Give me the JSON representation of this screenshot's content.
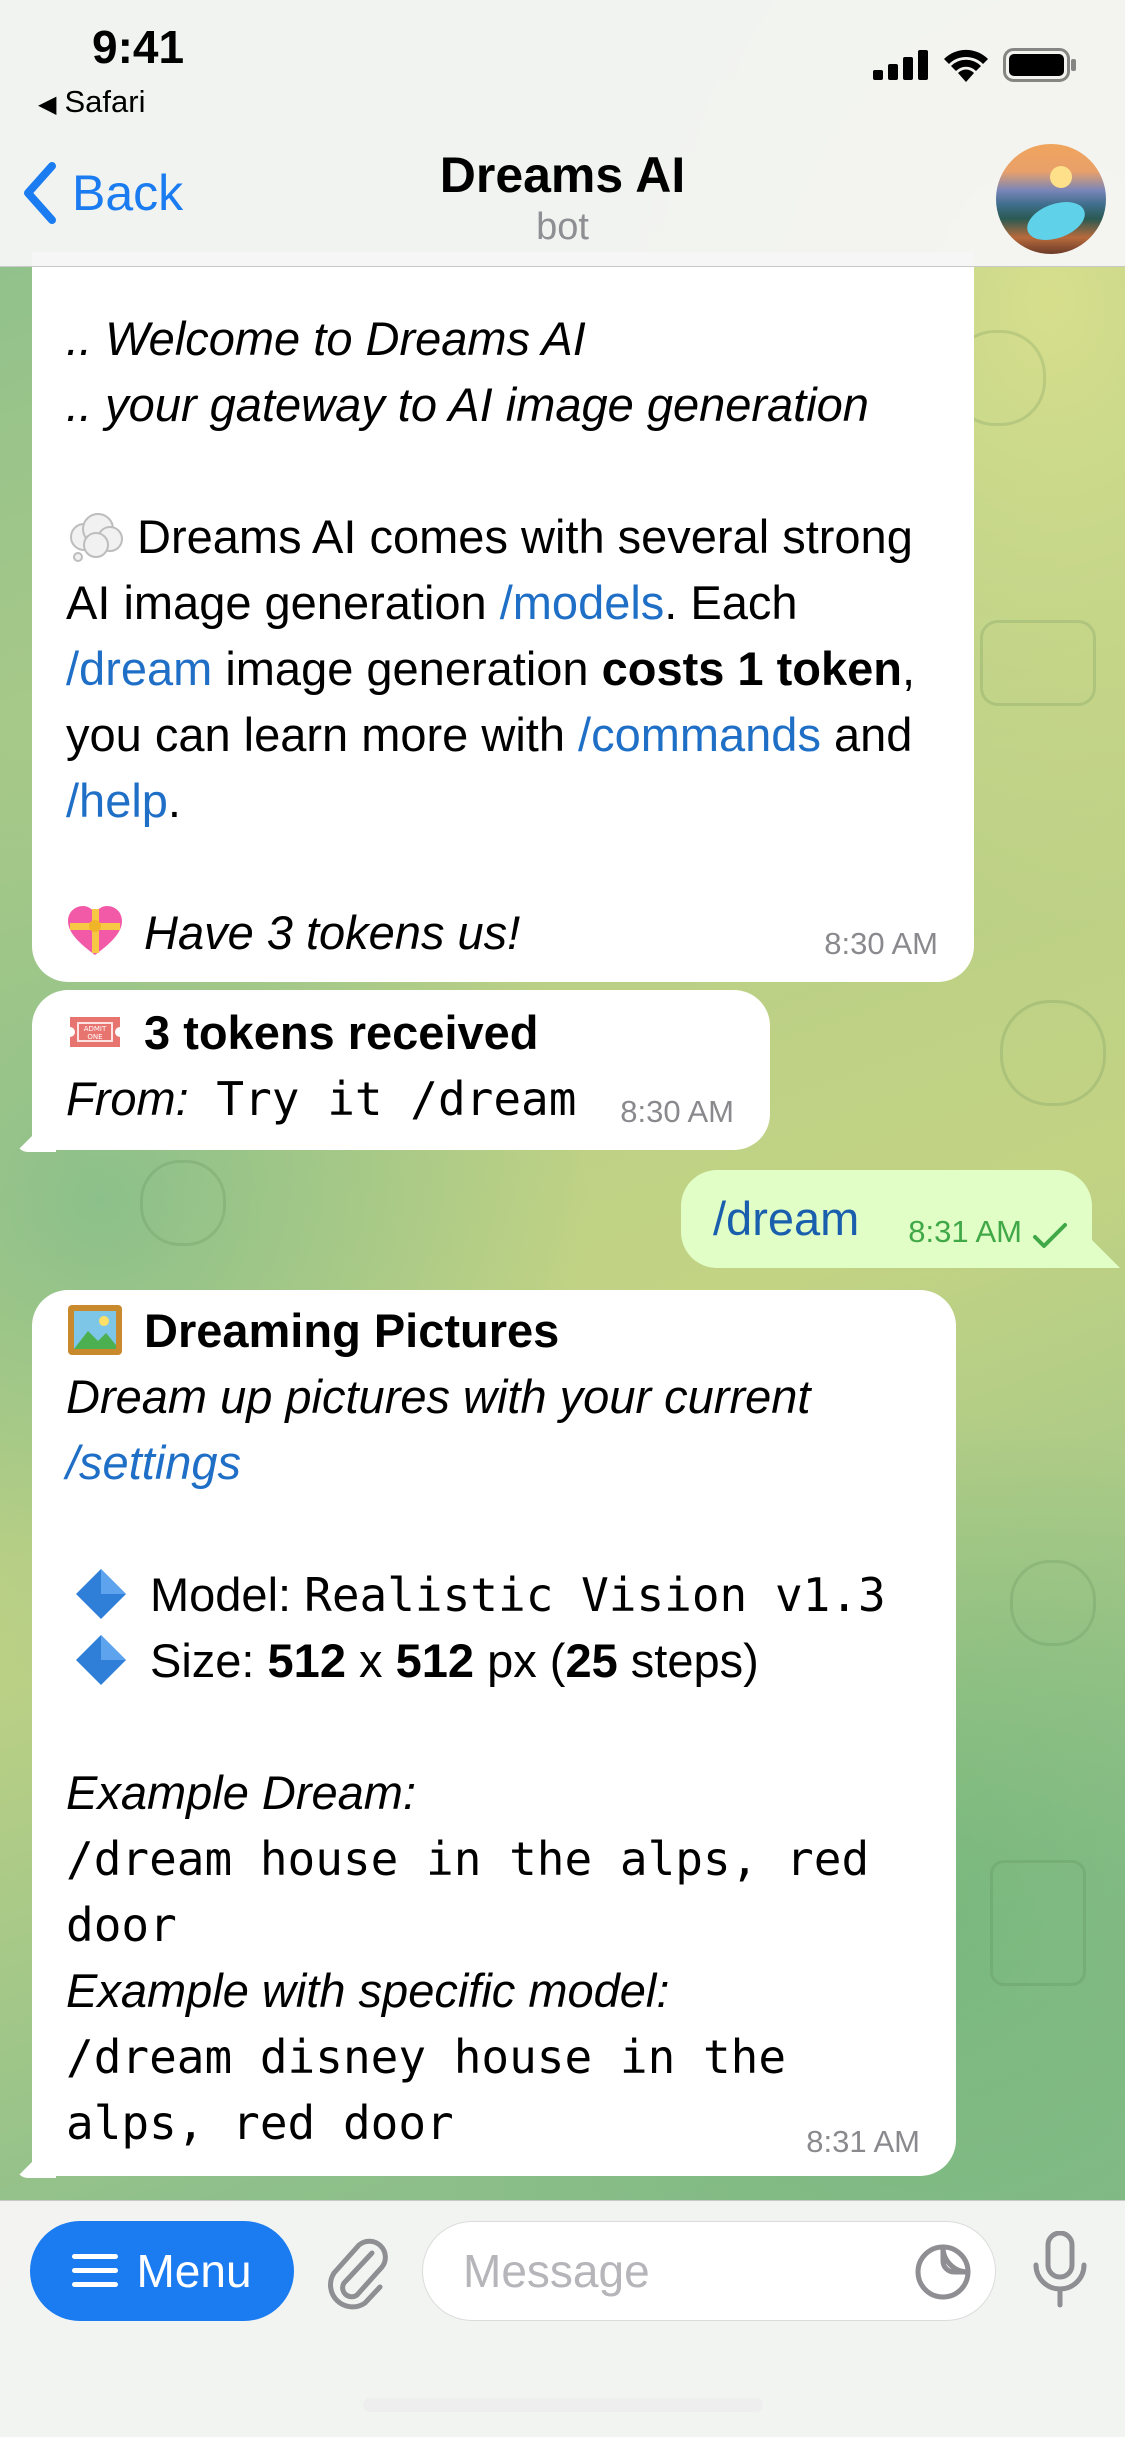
{
  "status_bar": {
    "time": "9:41",
    "back_app": "Safari",
    "icons": [
      "signal-icon",
      "wifi-icon",
      "battery-icon"
    ]
  },
  "header": {
    "back_label": "Back",
    "title": "Dreams AI",
    "subtitle": "bot"
  },
  "messages": {
    "m1": {
      "line1": ".. Welcome to Dreams AI",
      "line2": ".. your gateway to AI image generation",
      "p1_a": " Dreams AI comes with several strong AI image generation ",
      "p1_link_models": "/models",
      "p1_b": ". Each ",
      "p1_link_dream": "/dream",
      "p1_c": " image generation ",
      "p1_bold": "costs 1 token",
      "p1_d": ", you can learn more with ",
      "p1_link_commands": "/commands",
      "p1_e": " and ",
      "p1_link_help": "/help",
      "p1_f": ".",
      "gift": "Have 3 tokens us!",
      "time": "8:30 AM"
    },
    "m2": {
      "title": "3 tokens received",
      "from_label": "From:",
      "from_value": " Try it /dream",
      "time": "8:30 AM"
    },
    "m3": {
      "text": "/dream",
      "time": "8:31 AM"
    },
    "m4": {
      "title": "Dreaming Pictures",
      "subtitle_a": "Dream up pictures with your current ",
      "subtitle_link": "/settings",
      "model_label": "Model: ",
      "model_value": "Realistic Vision v1.3",
      "size_label": "Size: ",
      "size_w": "512",
      "size_x": " x ",
      "size_h": "512",
      "size_px": " px (",
      "size_steps": "25",
      "size_end": " steps)",
      "example1_label": "Example Dream:",
      "example1_code": "/dream house in the alps, red door",
      "example2_label": "Example with specific model:",
      "example2_code": "/dream disney house in the alps, red door",
      "time": "8:31 AM"
    }
  },
  "input_bar": {
    "menu_label": "Menu",
    "placeholder": "Message"
  },
  "colors": {
    "accent": "#1a7cf0",
    "link": "#1f6fc7",
    "outgoing_bubble": "#e1fec6",
    "read_check": "#41a847"
  }
}
